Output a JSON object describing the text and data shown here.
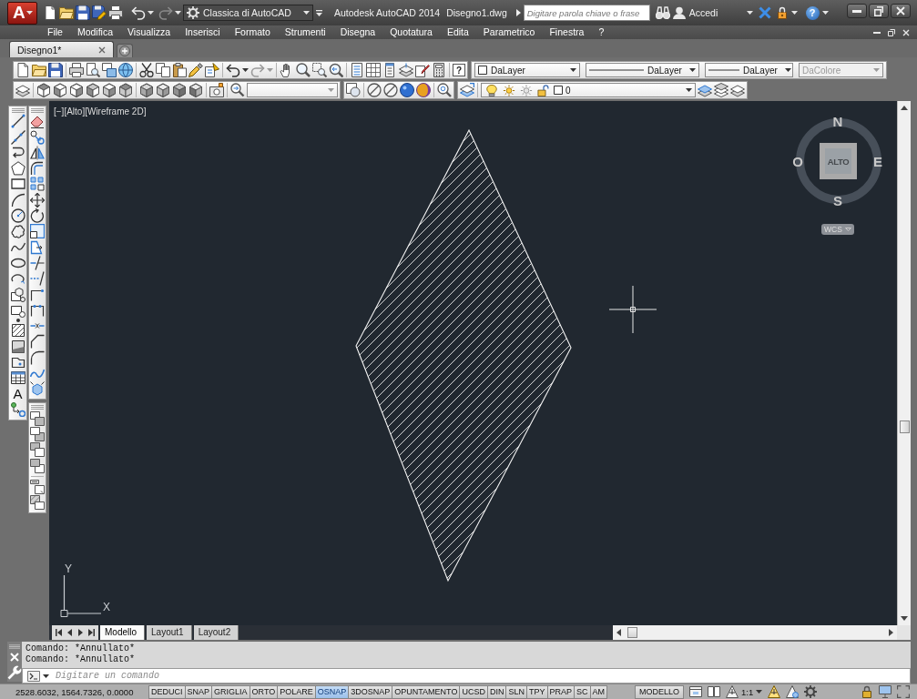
{
  "title_bar": {
    "app_button": "A",
    "workspace": "Classica di AutoCAD",
    "app_name": "Autodesk AutoCAD 2014",
    "file_name": "Disegno1.dwg",
    "search": {
      "placeholder": "Digitare parola chiave o frase"
    },
    "sign_in": "Accedi",
    "help": "?"
  },
  "menu_bar": {
    "items": [
      "File",
      "Modifica",
      "Visualizza",
      "Inserisci",
      "Formato",
      "Strumenti",
      "Disegna",
      "Quotatura",
      "Edita",
      "Parametrico",
      "Finestra",
      "?"
    ]
  },
  "document_tabs": [
    {
      "label": "Disegno1*",
      "selected": true
    }
  ],
  "toolbars": {
    "help": "?",
    "layer": "DaLayer",
    "linetype": "DaLayer",
    "lineweight": "DaLayer",
    "color": {
      "value": "DaColore",
      "disabled": true
    },
    "current_layer": "0",
    "text_tool": "A"
  },
  "viewport": {
    "controls": "[−][Alto][Wireframe 2D]",
    "viewcube": {
      "face": "ALTO",
      "north": "N",
      "south": "S",
      "east": "E",
      "west": "O",
      "coordinate_system": "WCS"
    },
    "ucs_icon": {
      "x_axis": "X",
      "y_axis": "Y"
    }
  },
  "layout_tabs": [
    {
      "label": "Modello",
      "selected": true
    },
    {
      "label": "Layout1",
      "selected": false
    },
    {
      "label": "Layout2",
      "selected": false
    }
  ],
  "command_line": {
    "history": [
      "Comando: *Annullato*",
      "Comando: *Annullato*"
    ],
    "placeholder": "Digitare un comando"
  },
  "status_bar": {
    "coordinates": "2528.6032, 1564.7326, 0.0000",
    "toggles": [
      {
        "label": "DEDUCI",
        "on": false
      },
      {
        "label": "SNAP",
        "on": false
      },
      {
        "label": "GRIGLIA",
        "on": false
      },
      {
        "label": "ORTO",
        "on": false
      },
      {
        "label": "POLARE",
        "on": false
      },
      {
        "label": "OSNAP",
        "on": true
      },
      {
        "label": "3DOSNAP",
        "on": false
      },
      {
        "label": "OPUNTAMENTO",
        "on": false
      },
      {
        "label": "UCSD",
        "on": false
      },
      {
        "label": "DIN",
        "on": false
      },
      {
        "label": "SLN",
        "on": false
      },
      {
        "label": "TPY",
        "on": false
      },
      {
        "label": "PRAP",
        "on": false
      },
      {
        "label": "SC",
        "on": false
      },
      {
        "label": "AM",
        "on": false
      }
    ],
    "space": "MODELLO",
    "annotation_scale": "1:1"
  }
}
